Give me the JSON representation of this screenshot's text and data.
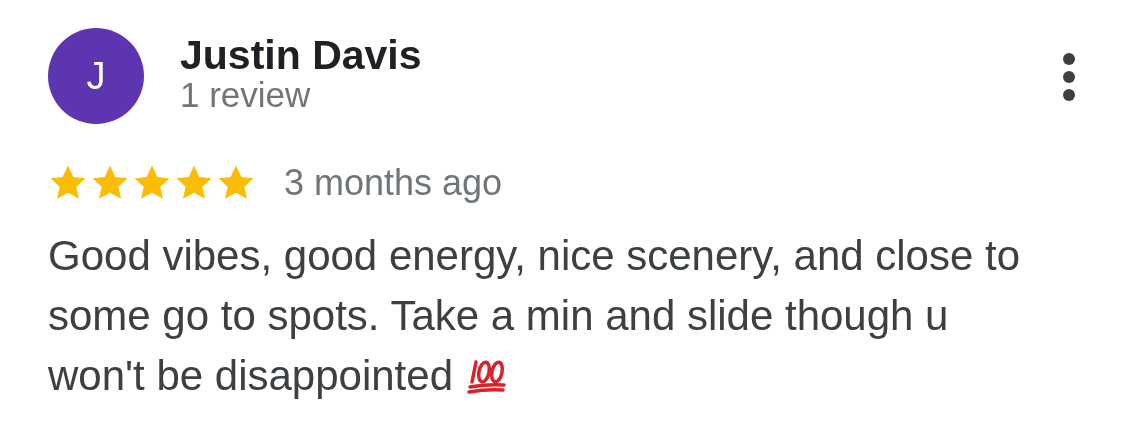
{
  "reviewer": {
    "initial": "J",
    "name": "Justin Davis",
    "review_count": "1 review"
  },
  "review": {
    "stars": 5,
    "time": "3 months ago",
    "text": "Good vibes, good energy, nice scenery, and close to some go to spots. Take a min and slide though u won't be disappointed"
  }
}
